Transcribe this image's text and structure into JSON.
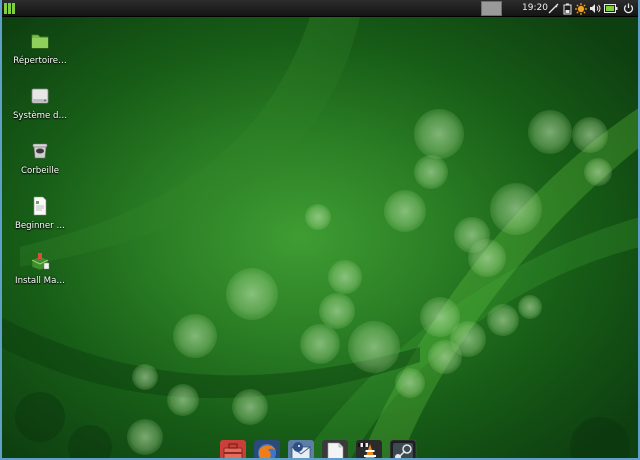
{
  "panel": {
    "menu_icon": "desktop-menu-icon",
    "clock": "19:20",
    "tray_icons": [
      "pen-tool-icon",
      "battery-monitor-icon",
      "update-sun-icon",
      "volume-icon",
      "battery-icon",
      "power-icon"
    ]
  },
  "desktop": {
    "icons": [
      {
        "label": "Répertoire…",
        "icon": "folder-icon"
      },
      {
        "label": "Système d…",
        "icon": "drive-icon"
      },
      {
        "label": "Corbeille",
        "icon": "trash-icon"
      },
      {
        "label": "Beginner …",
        "icon": "document-icon"
      },
      {
        "label": "Install Ma…",
        "icon": "installer-icon"
      }
    ]
  },
  "dock": {
    "items": [
      "toolbox-icon",
      "firefox-icon",
      "thunderbird-icon",
      "blank-document-icon",
      "vlc-icon",
      "steam-icon"
    ]
  },
  "colors": {
    "wallpaper": "#2a7d24",
    "panel": "#1e1e1e",
    "menu_accent": "#7fcf3f"
  }
}
